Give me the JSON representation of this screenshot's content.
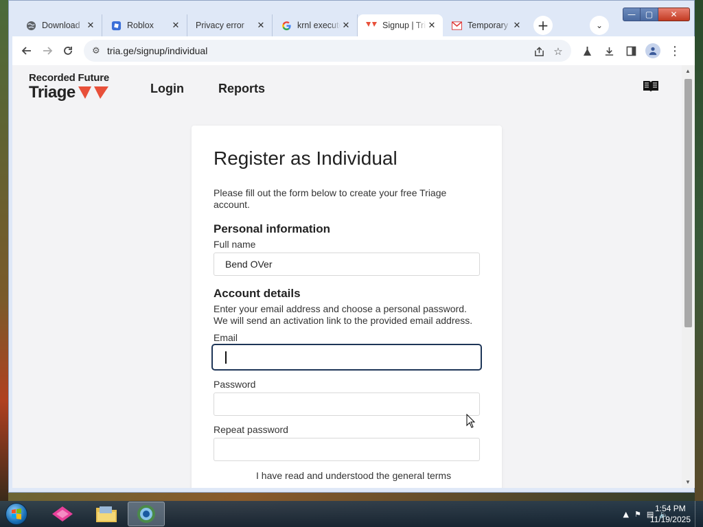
{
  "browser": {
    "tabs": [
      {
        "label": "Download",
        "icon": "globe-icon"
      },
      {
        "label": "Roblox",
        "icon": "roblox-icon"
      },
      {
        "label": "Privacy error",
        "icon": "none"
      },
      {
        "label": "krnl executor",
        "icon": "google-icon"
      },
      {
        "label": "Signup | Triage",
        "icon": "triage-icon",
        "active": true
      },
      {
        "label": "Temporary",
        "icon": "mail-icon"
      }
    ],
    "new_tab_symbol": "+",
    "url": "tria.ge/signup/individual"
  },
  "site": {
    "logo_top": "Recorded Future",
    "logo_bottom": "Triage",
    "nav": [
      "Login",
      "Reports"
    ],
    "brand_color": "#e8503a"
  },
  "form": {
    "title": "Register as Individual",
    "intro": "Please fill out the form below to create your free Triage account.",
    "personal_heading": "Personal information",
    "fullname_label": "Full name",
    "fullname_value": "Bend OVer",
    "account_heading": "Account details",
    "account_text": "Enter your email address and choose a personal password. We will send an activation link to the provided email address.",
    "email_label": "Email",
    "email_value": "",
    "password_label": "Password",
    "repeat_password_label": "Repeat password",
    "terms_text": "I have read and understood the general terms"
  },
  "taskbar": {
    "time": "1:54 PM",
    "date": "11/19/2025"
  }
}
